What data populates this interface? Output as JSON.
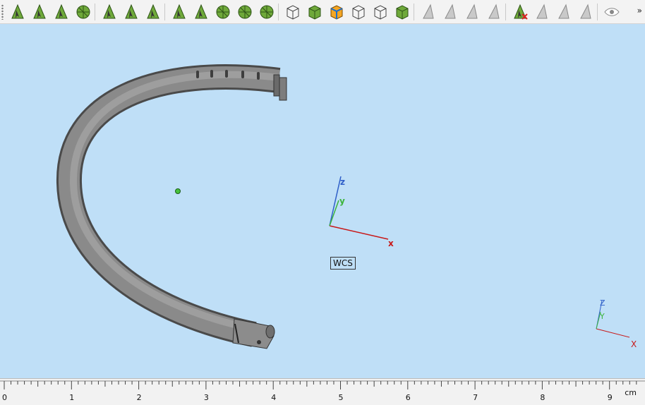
{
  "toolbar": {
    "overflow_label": "»",
    "groups": [
      [
        "select-icon",
        "select-face-icon",
        "select-edge-icon",
        "select-solid-icon"
      ],
      [
        "select-rect-icon",
        "select-circle-icon",
        "select-curve-icon"
      ],
      [
        "select-mesh-icon",
        "select-node-icon",
        "select-fan-icon",
        "select-wheel-icon",
        "select-radial-icon"
      ],
      [
        "view-iso-icon",
        "view-front-icon",
        "view-shaded-icon",
        "view-wire-icon",
        "view-section-icon",
        "view-render-icon"
      ],
      [
        "tool-pointer-icon",
        "tool-split-icon",
        "tool-cut-icon",
        "tool-extend-icon"
      ],
      [
        "tool-delete-icon",
        "tool-mirror-icon",
        "tool-copy-icon",
        "tool-plane-icon"
      ],
      [
        "visibility-eye-icon"
      ]
    ]
  },
  "viewport": {
    "background": "#bfdff7",
    "wcs_label": "WCS",
    "axis_labels": {
      "x": "x",
      "y": "y",
      "z": "z"
    },
    "mini_axis_labels": {
      "x": "X",
      "y": "Y",
      "z": "Z"
    },
    "colors": {
      "x": "#c81818",
      "y": "#3cb43c",
      "z": "#2f5fc8"
    }
  },
  "ruler": {
    "unit": "cm",
    "labels": [
      "0",
      "1",
      "2",
      "3",
      "4",
      "5",
      "6",
      "7",
      "8",
      "9"
    ]
  }
}
